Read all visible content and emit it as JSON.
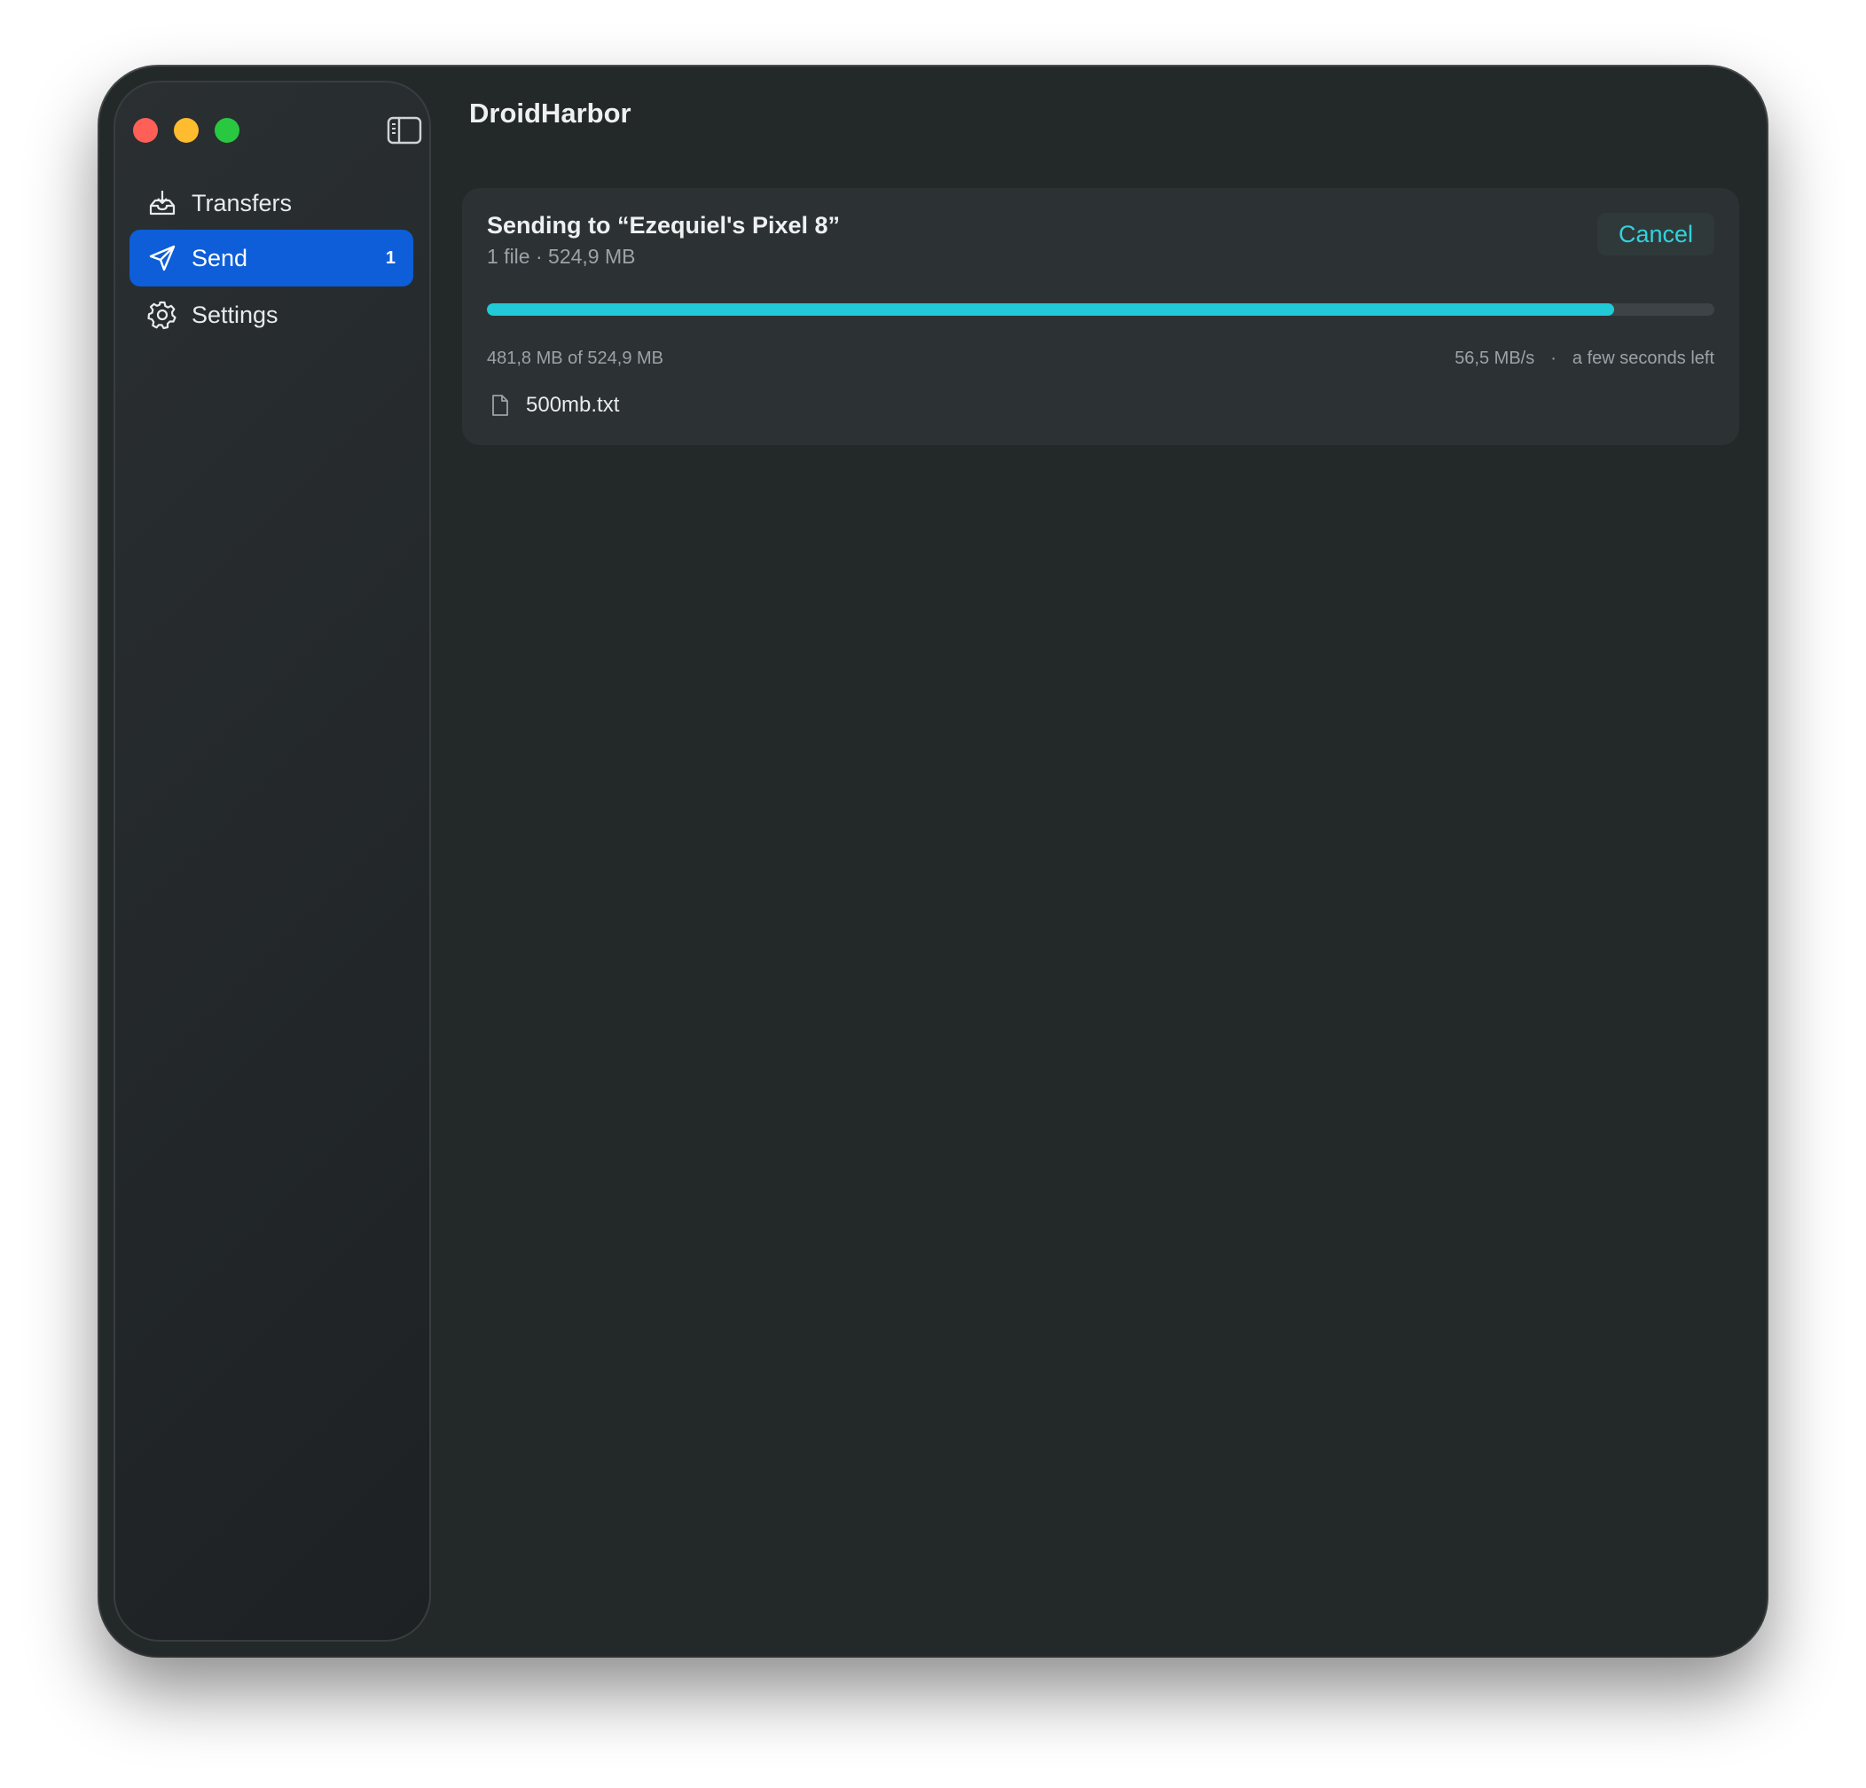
{
  "app": {
    "title": "DroidHarbor"
  },
  "sidebar": {
    "items": [
      {
        "label": "Transfers",
        "icon": "tray-download-icon"
      },
      {
        "label": "Send",
        "icon": "paper-plane-icon",
        "badge": "1",
        "active": true
      },
      {
        "label": "Settings",
        "icon": "gear-icon"
      }
    ]
  },
  "transfer": {
    "title": "Sending to “Ezequiel's Pixel 8”",
    "subtitle": "1 file · 524,9 MB",
    "cancel_label": "Cancel",
    "progress_fraction": 0.918,
    "progress_text": "481,8 MB of 524,9 MB",
    "speed": "56,5 MB/s",
    "separator": "·",
    "eta": "a few seconds left",
    "file_name": "500mb.txt",
    "file_icon": "document-icon"
  },
  "colors": {
    "accent": "#22c9d6",
    "selected_nav": "#0d5ed8",
    "window_bg": "#232829"
  }
}
